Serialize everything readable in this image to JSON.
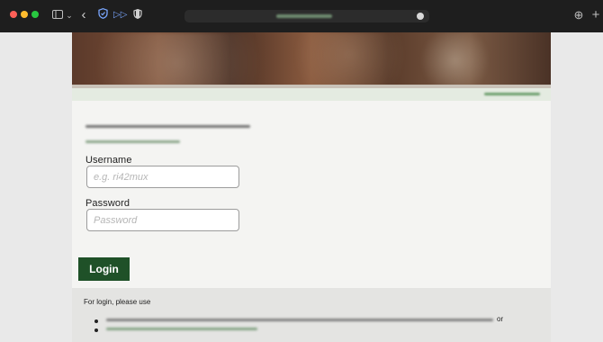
{
  "browser": {
    "icons": {
      "sidebar": "sidebar-icon",
      "chevron": "chevron-down-icon",
      "back": "back-icon",
      "shield": "shield-icon",
      "forward": "forward-icon",
      "privacy": "privacy-icon",
      "download": "download-icon",
      "new_tab": "plus-icon"
    },
    "colors": {
      "chrome_bg": "#1e1e1e",
      "close": "#ff5f57",
      "minimize": "#febc2e",
      "zoom": "#28c840",
      "accent_icon": "#7aa7ff"
    }
  },
  "login_form": {
    "username_label": "Username",
    "username_placeholder": "e.g. ri42mux",
    "username_value": "",
    "password_label": "Password",
    "password_placeholder": "Password",
    "password_value": "",
    "submit_label": "Login",
    "submit_color": "#1f5128"
  },
  "info": {
    "text": "For login, please use",
    "or_text": "or"
  }
}
